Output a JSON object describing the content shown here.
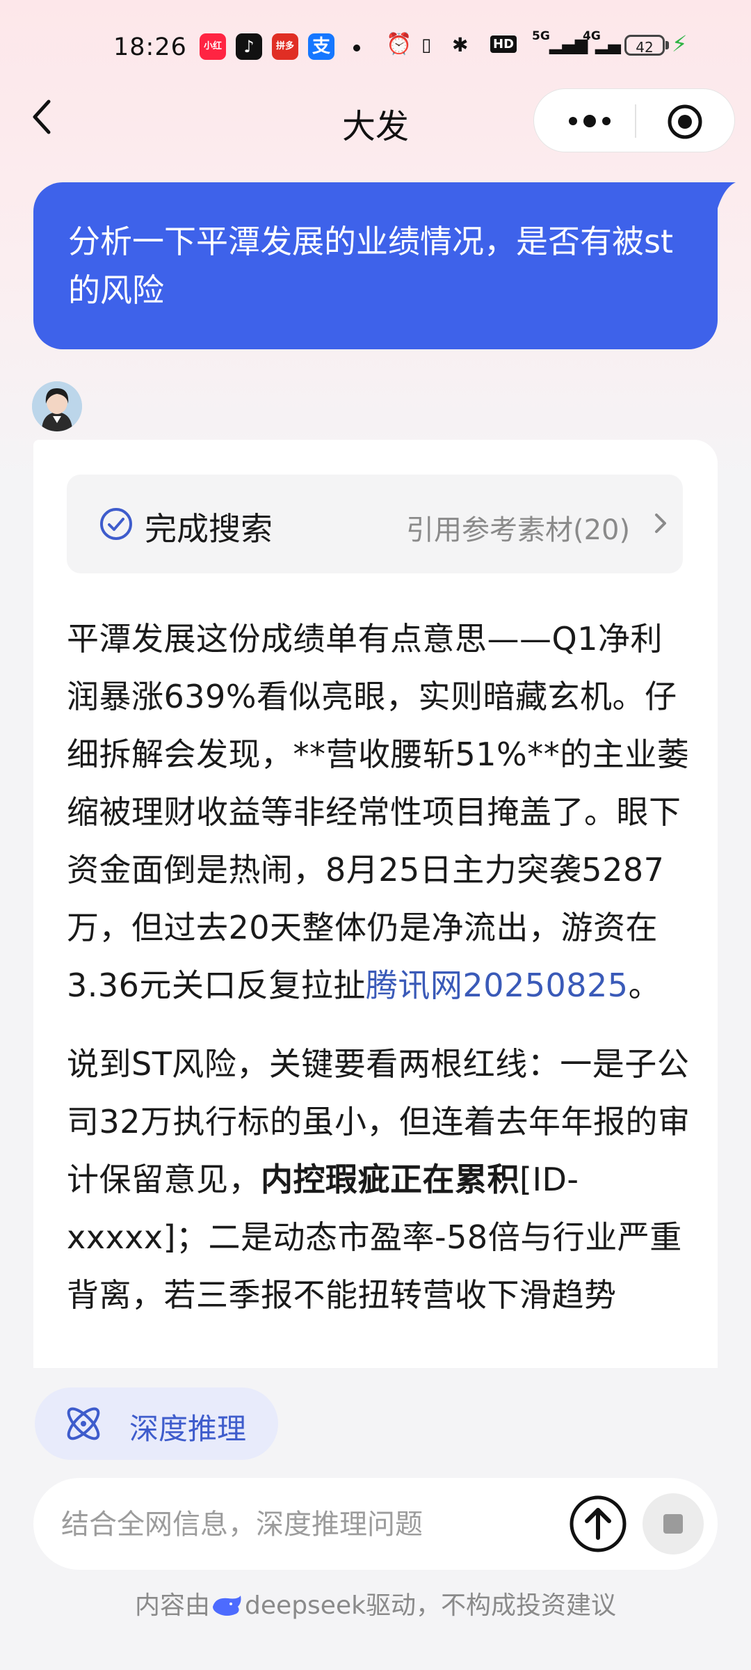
{
  "status_bar": {
    "time": "18:26",
    "apps": [
      {
        "name": "小红书",
        "color": "#ff2442"
      },
      {
        "name": "抖音",
        "color": "#111111"
      },
      {
        "name": "拼多多",
        "color": "#e02e24"
      },
      {
        "name": "支",
        "color": "#1677ff"
      }
    ],
    "network_label": "5G",
    "network_label_2": "4G",
    "battery": "42",
    "hd_label": "HD"
  },
  "nav": {
    "title": "大发"
  },
  "conversation": {
    "user_message": "分析一下平潭发展的业绩情况，是否有被st的风险",
    "search": {
      "status": "完成搜索",
      "references": "引用参考素材(20)"
    },
    "answer": {
      "p1_text": "平潭发展这份成绩单有点意思——Q1净利润暴涨639%看似亮眼，实则暗藏玄机。仔细拆解会发现，**营收腰斩51%**的主业萎缩被理财收益等非经常性项目掩盖了。眼下资金面倒是热闹，8月25日主力突袭5287万，但过去20天整体仍是净流出，游资在3.36元关口反复拉扯",
      "p1_link": "腾讯网20250825",
      "p1_end": "。",
      "p2_start": "说到ST风险，关键要看两根红线：一是子公司32万执行标的虽小，但连着去年年报的审计保留意见，",
      "p2_bold": "内控瑕疵正在累积",
      "p2_rest": "[ID-xxxxx]；二是动态市盈率-58倍与行业严重背离，若三季报不能扭转营收下滑趋势"
    }
  },
  "composer": {
    "mode_chip": "深度推理",
    "placeholder": "结合全网信息，深度推理问题"
  },
  "footer": {
    "prefix": "内容由",
    "brand": "deepseek",
    "suffix": "驱动，不构成投资建议"
  },
  "colors": {
    "accent": "#3e62ea",
    "link": "#3a5ab8",
    "chip_bg": "#e8ebfb",
    "header_gradient_top": "#fde7ea"
  }
}
